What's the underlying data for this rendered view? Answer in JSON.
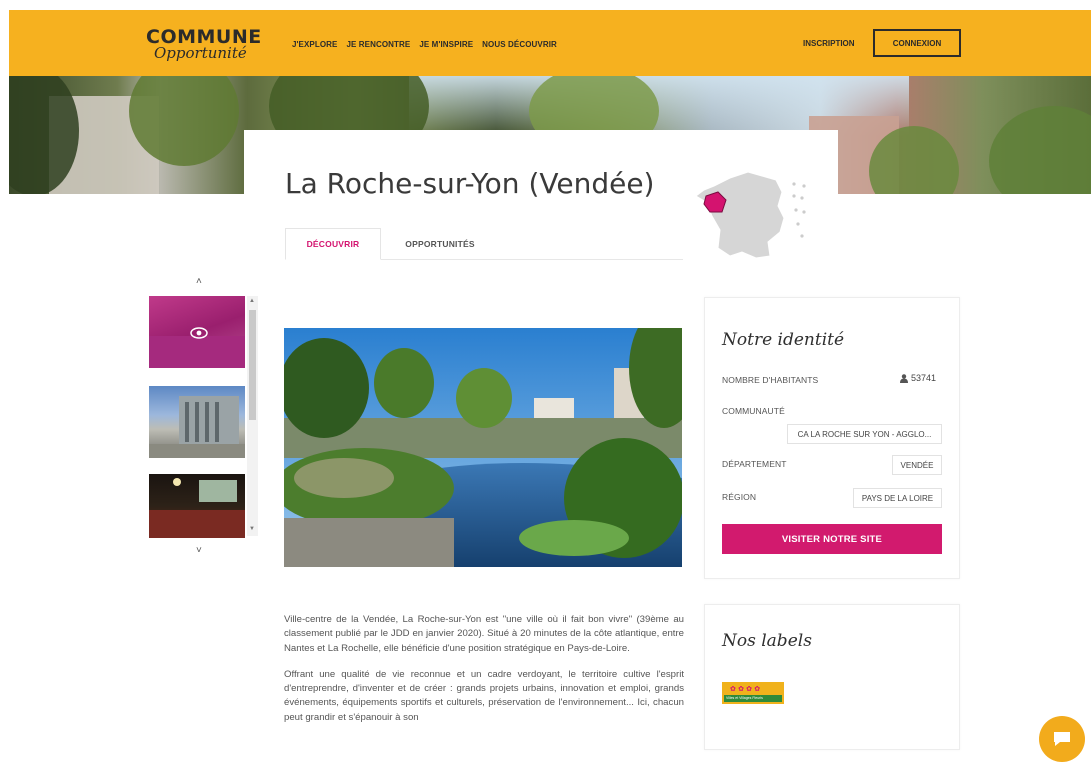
{
  "header": {
    "logo_top": "COMMUNE",
    "logo_bottom": "Opportunité",
    "nav": [
      "J'EXPLORE",
      "JE RENCONTRE",
      "JE M'INSPIRE",
      "NOUS DÉCOUVRIR"
    ],
    "signup": "INSCRIPTION",
    "login": "CONNEXION"
  },
  "colors": {
    "brand_yellow": "#f6b11f",
    "accent_pink": "#d4136f",
    "button_pink": "#d21a6e"
  },
  "city": {
    "title": "La Roche-sur-Yon (Vendée)"
  },
  "tabs": [
    {
      "label": "DÉCOUVRIR"
    },
    {
      "label": "OPPORTUNITÉS"
    }
  ],
  "gallery": {
    "up": "˄",
    "down": "˅"
  },
  "identity": {
    "title": "Notre identité",
    "inhabitants_label": "NOMBRE D'HABITANTS",
    "inhabitants_value": "53741",
    "community_label": "COMMUNAUTÉ",
    "community_value": "CA LA ROCHE SUR YON - AGGLO...",
    "department_label": "DÉPARTEMENT",
    "department_value": "VENDÉE",
    "region_label": "RÉGION",
    "region_value": "PAYS DE LA LOIRE",
    "visit_button": "VISITER NOTRE SITE"
  },
  "labels": {
    "title": "Nos labels",
    "badge_text": "Villes et Villages Fleuris"
  },
  "description": {
    "p1": "Ville-centre de la Vendée, La Roche-sur-Yon est \"une ville où il fait bon vivre\" (39ème au classement publié par le JDD en janvier 2020). Situé à 20 minutes de la côte atlantique, entre Nantes et La Rochelle, elle bénéficie d'une position stratégique en Pays-de-Loire.",
    "p2": "Offrant une qualité de vie reconnue et un cadre verdoyant, le territoire cultive l'esprit d'entreprendre, d'inventer et de créer : grands projets urbains, innovation et emploi, grands événements, équipements sportifs et culturels, préservation de l'environnement... Ici, chacun peut grandir et s'épanouir à son"
  }
}
